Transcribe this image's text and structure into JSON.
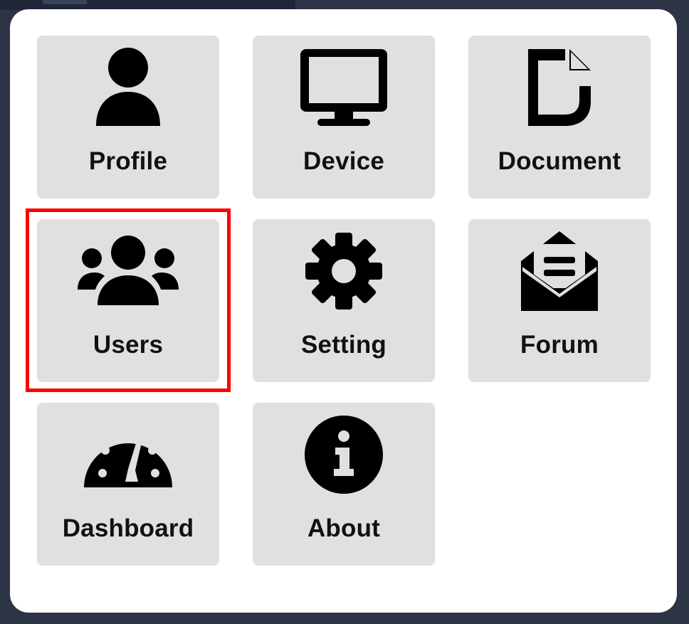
{
  "menu": {
    "items": [
      {
        "label": "Profile",
        "icon": "user-icon"
      },
      {
        "label": "Device",
        "icon": "monitor-icon"
      },
      {
        "label": "Document",
        "icon": "document-icon"
      },
      {
        "label": "Users",
        "icon": "users-icon"
      },
      {
        "label": "Setting",
        "icon": "gear-icon"
      },
      {
        "label": "Forum",
        "icon": "envelope-open-icon"
      },
      {
        "label": "Dashboard",
        "icon": "gauge-icon"
      },
      {
        "label": "About",
        "icon": "info-icon"
      }
    ],
    "highlighted_item": "Users"
  },
  "colors": {
    "tile_background": "#e0e0e0",
    "panel_background": "#ffffff",
    "highlight_border": "#ff0000",
    "backdrop": "#2d3445"
  }
}
